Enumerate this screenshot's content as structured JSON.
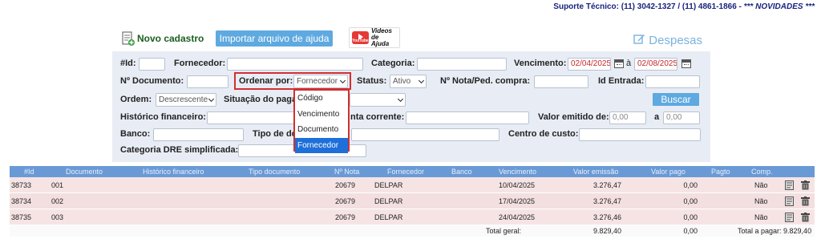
{
  "support": {
    "label": "Suporte Técnico: (11) 3042-1327 / (11) 4861-1866 - ",
    "news": "*** NOVIDADES ***"
  },
  "toolbar": {
    "new_label": "Novo cadastro",
    "import_label": "Importar arquivo de ajuda",
    "videos_line1": "Videos",
    "videos_line2": "de Ajuda",
    "youtube_text": "YouTube",
    "page_title": "Despesas"
  },
  "filters": {
    "id_label": "#Id:",
    "fornecedor_label": "Fornecedor:",
    "categoria_label": "Categoria:",
    "vencimento_label": "Vencimento:",
    "vencimento_from": "02/04/2025",
    "vencimento_sep": "à",
    "vencimento_to": "02/08/2025",
    "documento_label": "Nº Documento:",
    "ordenar_label": "Ordenar por:",
    "ordenar_value": "Fornecedor",
    "status_label": "Status:",
    "status_value": "Ativo",
    "nota_label": "Nº Nota/Ped. compra:",
    "identrada_label": "Id Entrada:",
    "ordem_label": "Ordem:",
    "ordem_value": "Descrescente",
    "situacao_label": "Situação do paga",
    "buscar_label": "Buscar",
    "historico_label": "Histórico financeiro:",
    "conta_label": "nta corrente:",
    "valor_label": "Valor emitido de:",
    "valor_from": "0,00",
    "valor_sep": "a",
    "valor_to": "0,00",
    "banco_label": "Banco:",
    "tipo_label": "Tipo de do",
    "centro_label": "Centro de custo:",
    "dre_label": "Categoria DRE simplificada:"
  },
  "dropdown": {
    "options": [
      "Código",
      "Vencimento",
      "Documento",
      "Fornecedor"
    ],
    "selected": "Fornecedor"
  },
  "table": {
    "headers": [
      "#Id",
      "Documento",
      "Histórico financeiro",
      "Tipo documento",
      "Nº Nota",
      "Fornecedor",
      "Banco",
      "Vencimento",
      "Valor emissão",
      "Valor pago",
      "Pagto",
      "Comp."
    ],
    "rows": [
      {
        "id": "38733",
        "documento": "001",
        "nota": "20679",
        "fornecedor": "DELPAR",
        "vencimento": "10/04/2025",
        "valor_emissao": "3.276,47",
        "valor_pago": "0,00",
        "comp": "Não"
      },
      {
        "id": "38734",
        "documento": "002",
        "nota": "20679",
        "fornecedor": "DELPAR",
        "vencimento": "17/04/2025",
        "valor_emissao": "3.276,47",
        "valor_pago": "0,00",
        "comp": "Não"
      },
      {
        "id": "38735",
        "documento": "003",
        "nota": "20679",
        "fornecedor": "DELPAR",
        "vencimento": "24/04/2025",
        "valor_emissao": "3.276,46",
        "valor_pago": "0,00",
        "comp": "Não"
      }
    ],
    "footer": {
      "total_label": "Total geral:",
      "total_emissao": "9.829,40",
      "total_pago": "0,00",
      "total_pagar": "Total a pagar: 9.829,40"
    }
  },
  "colors": {
    "accent": "#5ea9e0",
    "header_row": "#6a9ad6",
    "row_bg": "#f6e4e4",
    "highlight": "#d32f2f",
    "selected_option": "#1e6fd9"
  }
}
